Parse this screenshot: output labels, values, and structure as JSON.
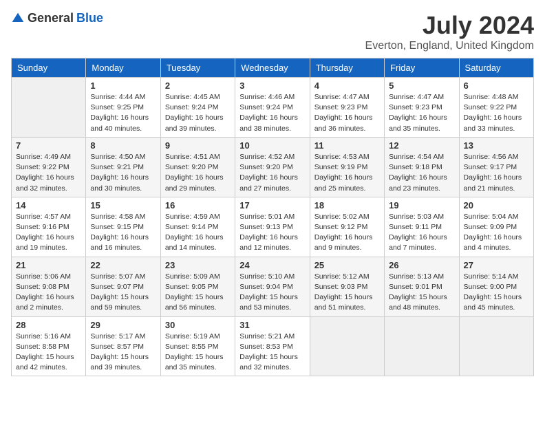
{
  "header": {
    "logo_general": "General",
    "logo_blue": "Blue",
    "month_year": "July 2024",
    "location": "Everton, England, United Kingdom"
  },
  "weekdays": [
    "Sunday",
    "Monday",
    "Tuesday",
    "Wednesday",
    "Thursday",
    "Friday",
    "Saturday"
  ],
  "weeks": [
    [
      {
        "day": "",
        "empty": true
      },
      {
        "day": "1",
        "sunrise": "Sunrise: 4:44 AM",
        "sunset": "Sunset: 9:25 PM",
        "daylight": "Daylight: 16 hours and 40 minutes."
      },
      {
        "day": "2",
        "sunrise": "Sunrise: 4:45 AM",
        "sunset": "Sunset: 9:24 PM",
        "daylight": "Daylight: 16 hours and 39 minutes."
      },
      {
        "day": "3",
        "sunrise": "Sunrise: 4:46 AM",
        "sunset": "Sunset: 9:24 PM",
        "daylight": "Daylight: 16 hours and 38 minutes."
      },
      {
        "day": "4",
        "sunrise": "Sunrise: 4:47 AM",
        "sunset": "Sunset: 9:23 PM",
        "daylight": "Daylight: 16 hours and 36 minutes."
      },
      {
        "day": "5",
        "sunrise": "Sunrise: 4:47 AM",
        "sunset": "Sunset: 9:23 PM",
        "daylight": "Daylight: 16 hours and 35 minutes."
      },
      {
        "day": "6",
        "sunrise": "Sunrise: 4:48 AM",
        "sunset": "Sunset: 9:22 PM",
        "daylight": "Daylight: 16 hours and 33 minutes."
      }
    ],
    [
      {
        "day": "7",
        "sunrise": "Sunrise: 4:49 AM",
        "sunset": "Sunset: 9:22 PM",
        "daylight": "Daylight: 16 hours and 32 minutes."
      },
      {
        "day": "8",
        "sunrise": "Sunrise: 4:50 AM",
        "sunset": "Sunset: 9:21 PM",
        "daylight": "Daylight: 16 hours and 30 minutes."
      },
      {
        "day": "9",
        "sunrise": "Sunrise: 4:51 AM",
        "sunset": "Sunset: 9:20 PM",
        "daylight": "Daylight: 16 hours and 29 minutes."
      },
      {
        "day": "10",
        "sunrise": "Sunrise: 4:52 AM",
        "sunset": "Sunset: 9:20 PM",
        "daylight": "Daylight: 16 hours and 27 minutes."
      },
      {
        "day": "11",
        "sunrise": "Sunrise: 4:53 AM",
        "sunset": "Sunset: 9:19 PM",
        "daylight": "Daylight: 16 hours and 25 minutes."
      },
      {
        "day": "12",
        "sunrise": "Sunrise: 4:54 AM",
        "sunset": "Sunset: 9:18 PM",
        "daylight": "Daylight: 16 hours and 23 minutes."
      },
      {
        "day": "13",
        "sunrise": "Sunrise: 4:56 AM",
        "sunset": "Sunset: 9:17 PM",
        "daylight": "Daylight: 16 hours and 21 minutes."
      }
    ],
    [
      {
        "day": "14",
        "sunrise": "Sunrise: 4:57 AM",
        "sunset": "Sunset: 9:16 PM",
        "daylight": "Daylight: 16 hours and 19 minutes."
      },
      {
        "day": "15",
        "sunrise": "Sunrise: 4:58 AM",
        "sunset": "Sunset: 9:15 PM",
        "daylight": "Daylight: 16 hours and 16 minutes."
      },
      {
        "day": "16",
        "sunrise": "Sunrise: 4:59 AM",
        "sunset": "Sunset: 9:14 PM",
        "daylight": "Daylight: 16 hours and 14 minutes."
      },
      {
        "day": "17",
        "sunrise": "Sunrise: 5:01 AM",
        "sunset": "Sunset: 9:13 PM",
        "daylight": "Daylight: 16 hours and 12 minutes."
      },
      {
        "day": "18",
        "sunrise": "Sunrise: 5:02 AM",
        "sunset": "Sunset: 9:12 PM",
        "daylight": "Daylight: 16 hours and 9 minutes."
      },
      {
        "day": "19",
        "sunrise": "Sunrise: 5:03 AM",
        "sunset": "Sunset: 9:11 PM",
        "daylight": "Daylight: 16 hours and 7 minutes."
      },
      {
        "day": "20",
        "sunrise": "Sunrise: 5:04 AM",
        "sunset": "Sunset: 9:09 PM",
        "daylight": "Daylight: 16 hours and 4 minutes."
      }
    ],
    [
      {
        "day": "21",
        "sunrise": "Sunrise: 5:06 AM",
        "sunset": "Sunset: 9:08 PM",
        "daylight": "Daylight: 16 hours and 2 minutes."
      },
      {
        "day": "22",
        "sunrise": "Sunrise: 5:07 AM",
        "sunset": "Sunset: 9:07 PM",
        "daylight": "Daylight: 15 hours and 59 minutes."
      },
      {
        "day": "23",
        "sunrise": "Sunrise: 5:09 AM",
        "sunset": "Sunset: 9:05 PM",
        "daylight": "Daylight: 15 hours and 56 minutes."
      },
      {
        "day": "24",
        "sunrise": "Sunrise: 5:10 AM",
        "sunset": "Sunset: 9:04 PM",
        "daylight": "Daylight: 15 hours and 53 minutes."
      },
      {
        "day": "25",
        "sunrise": "Sunrise: 5:12 AM",
        "sunset": "Sunset: 9:03 PM",
        "daylight": "Daylight: 15 hours and 51 minutes."
      },
      {
        "day": "26",
        "sunrise": "Sunrise: 5:13 AM",
        "sunset": "Sunset: 9:01 PM",
        "daylight": "Daylight: 15 hours and 48 minutes."
      },
      {
        "day": "27",
        "sunrise": "Sunrise: 5:14 AM",
        "sunset": "Sunset: 9:00 PM",
        "daylight": "Daylight: 15 hours and 45 minutes."
      }
    ],
    [
      {
        "day": "28",
        "sunrise": "Sunrise: 5:16 AM",
        "sunset": "Sunset: 8:58 PM",
        "daylight": "Daylight: 15 hours and 42 minutes."
      },
      {
        "day": "29",
        "sunrise": "Sunrise: 5:17 AM",
        "sunset": "Sunset: 8:57 PM",
        "daylight": "Daylight: 15 hours and 39 minutes."
      },
      {
        "day": "30",
        "sunrise": "Sunrise: 5:19 AM",
        "sunset": "Sunset: 8:55 PM",
        "daylight": "Daylight: 15 hours and 35 minutes."
      },
      {
        "day": "31",
        "sunrise": "Sunrise: 5:21 AM",
        "sunset": "Sunset: 8:53 PM",
        "daylight": "Daylight: 15 hours and 32 minutes."
      },
      {
        "day": "",
        "empty": true
      },
      {
        "day": "",
        "empty": true
      },
      {
        "day": "",
        "empty": true
      }
    ]
  ]
}
